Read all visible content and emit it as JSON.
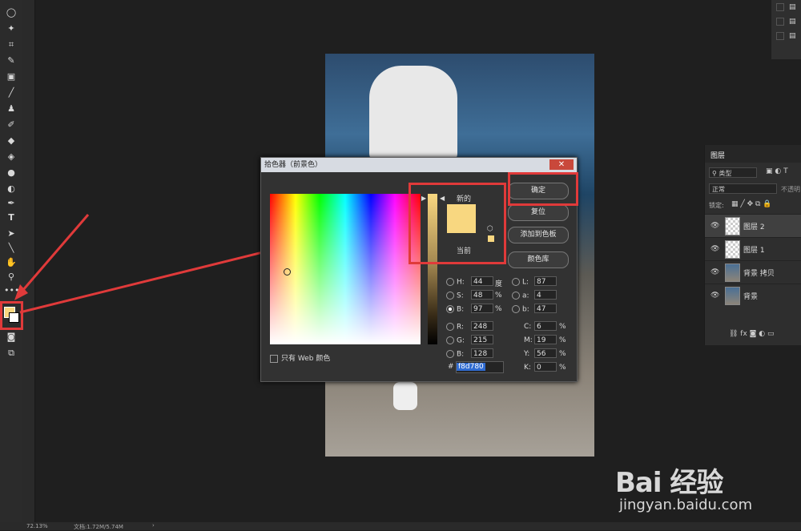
{
  "dialog": {
    "title": "拾色器（前景色）",
    "new_label": "新的",
    "current_label": "当前",
    "ok_button": "确定",
    "reset_button": "复位",
    "add_swatch_button": "添加到色板",
    "color_library_button": "颜色库",
    "web_only_label": "只有 Web 颜色",
    "hex_prefix": "#",
    "hex": "f8d780",
    "hsb": {
      "h_label": "H:",
      "h": "44",
      "h_unit": "度",
      "s_label": "S:",
      "s": "48",
      "s_unit": "%",
      "b_label": "B:",
      "b": "97",
      "b_unit": "%"
    },
    "rgb": {
      "r_label": "R:",
      "r": "248",
      "g_label": "G:",
      "g": "215",
      "b_label": "B:",
      "b": "128"
    },
    "lab": {
      "l_label": "L:",
      "l": "87",
      "a_label": "a:",
      "a": "4",
      "b_label": "b:",
      "b": "47"
    },
    "cmyk": {
      "c_label": "C:",
      "c": "6",
      "m_label": "M:",
      "m": "19",
      "y_label": "Y:",
      "y": "56",
      "k_label": "K:",
      "k": "0",
      "unit": "%"
    }
  },
  "layers_panel": {
    "tab": "图层",
    "filter": "类型",
    "blend_mode": "正常",
    "opacity_label": "不透明",
    "lock_label": "锁定:",
    "layers": [
      {
        "name": "图层 2"
      },
      {
        "name": "图层 1"
      },
      {
        "name": "背景 拷贝"
      },
      {
        "name": "背景"
      }
    ]
  },
  "status": {
    "zoom": "72.13%",
    "doc": "文档:1.72M/5.74M"
  },
  "watermark": {
    "logo": "Bai 经验",
    "url": "jingyan.baidu.com"
  },
  "colors": {
    "foreground": "#f8d780",
    "annotation": "#e03a3a"
  }
}
